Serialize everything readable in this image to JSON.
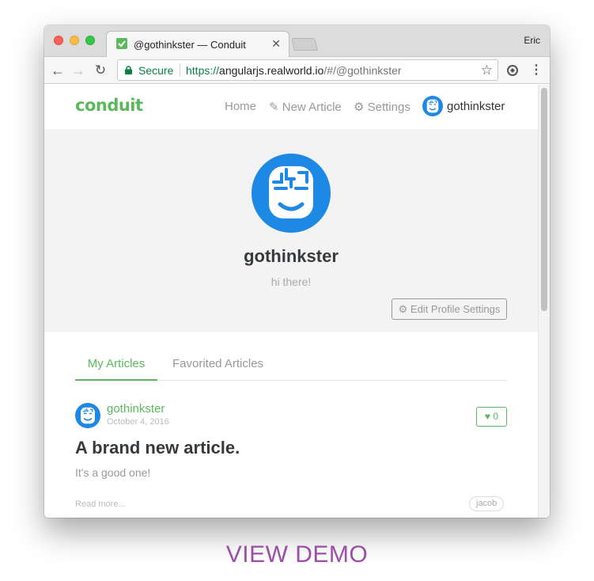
{
  "browser": {
    "tab_title": "@gothinkster — Conduit",
    "tab_close": "✕",
    "user": "Eric",
    "secure_label": "Secure",
    "url_scheme": "https://",
    "url_host": "angularjs.realworld.io",
    "url_path": "/#/@gothinkster"
  },
  "navbar": {
    "brand": "conduit",
    "home": "Home",
    "new_article": "New Article",
    "settings": "Settings",
    "username": "gothinkster"
  },
  "profile": {
    "name": "gothinkster",
    "bio": "hi there!",
    "edit_button": "Edit Profile Settings"
  },
  "feed_tabs": {
    "my_articles": "My Articles",
    "favorited_articles": "Favorited Articles"
  },
  "article": {
    "author": "gothinkster",
    "date": "October 4, 2016",
    "favorites_count": "0",
    "title": "A brand new article.",
    "description": "It's a good one!",
    "read_more": "Read more...",
    "tag": "jacob"
  },
  "footer": {
    "demo_label": "VIEW DEMO"
  },
  "colors": {
    "accent": "#5cb85c",
    "demo": "#9b4fa6",
    "avatar_blue": "#1e88e5"
  },
  "icons": {
    "favicon": "conduit-favicon",
    "lock": "lock-icon",
    "star": "bookmark-star-icon",
    "edit": "compose-icon",
    "gear": "gear-icon",
    "heart": "heart-icon"
  }
}
